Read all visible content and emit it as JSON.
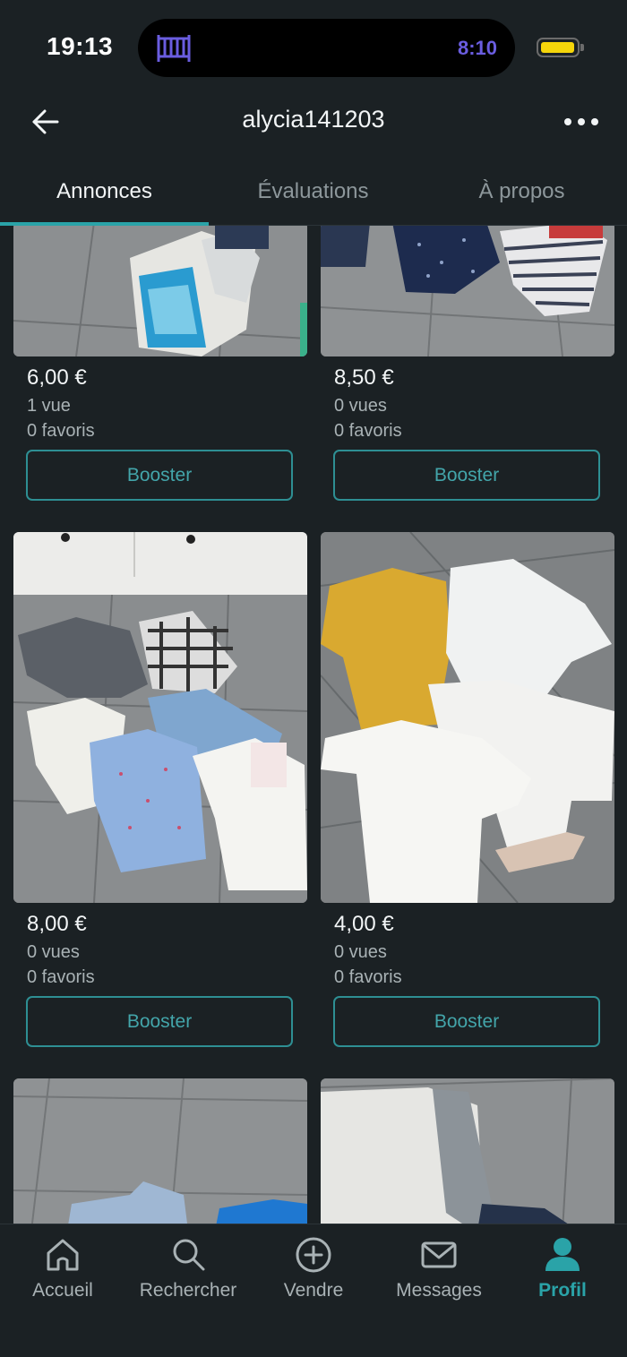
{
  "status_bar": {
    "time": "19:13",
    "activity_timer": "8:10",
    "activity_icon": "crib-icon",
    "battery_color": "#f5d50a"
  },
  "header": {
    "title": "alycia141203",
    "back_icon": "arrow-left-icon",
    "more_icon": "more-horizontal-icon"
  },
  "tabs": [
    {
      "label": "Annonces",
      "active": true
    },
    {
      "label": "Évaluations",
      "active": false
    },
    {
      "label": "À propos",
      "active": false
    }
  ],
  "listings": [
    {
      "price": "6,00 €",
      "views": "1 vue",
      "favorites": "0 favoris",
      "button": "Booster",
      "photo": "baby shirts on tiled floor"
    },
    {
      "price": "8,50 €",
      "views": "0 vues",
      "favorites": "0 favoris",
      "button": "Booster",
      "photo": "baby bodysuits on tiled floor"
    },
    {
      "price": "8,00 €",
      "views": "0 vues",
      "favorites": "0 favoris",
      "button": "Booster",
      "photo": "six baby shirts on tiled floor"
    },
    {
      "price": "4,00 €",
      "views": "0 vues",
      "favorites": "0 favoris",
      "button": "Booster",
      "photo": "four baby bodysuits on tiled floor"
    },
    {
      "photo": "baby shorts on tiled floor"
    },
    {
      "photo": "baby trousers on tiled floor"
    }
  ],
  "bottom_nav": [
    {
      "label": "Accueil",
      "icon": "home-icon",
      "active": false
    },
    {
      "label": "Rechercher",
      "icon": "search-icon",
      "active": false
    },
    {
      "label": "Vendre",
      "icon": "plus-circle-icon",
      "active": false
    },
    {
      "label": "Messages",
      "icon": "mail-icon",
      "active": false
    },
    {
      "label": "Profil",
      "icon": "profile-icon",
      "active": true
    }
  ],
  "colors": {
    "background": "#1b2124",
    "accent": "#2aa3a8",
    "text": "#f2f5f6",
    "muted": "#a9b2b5"
  }
}
